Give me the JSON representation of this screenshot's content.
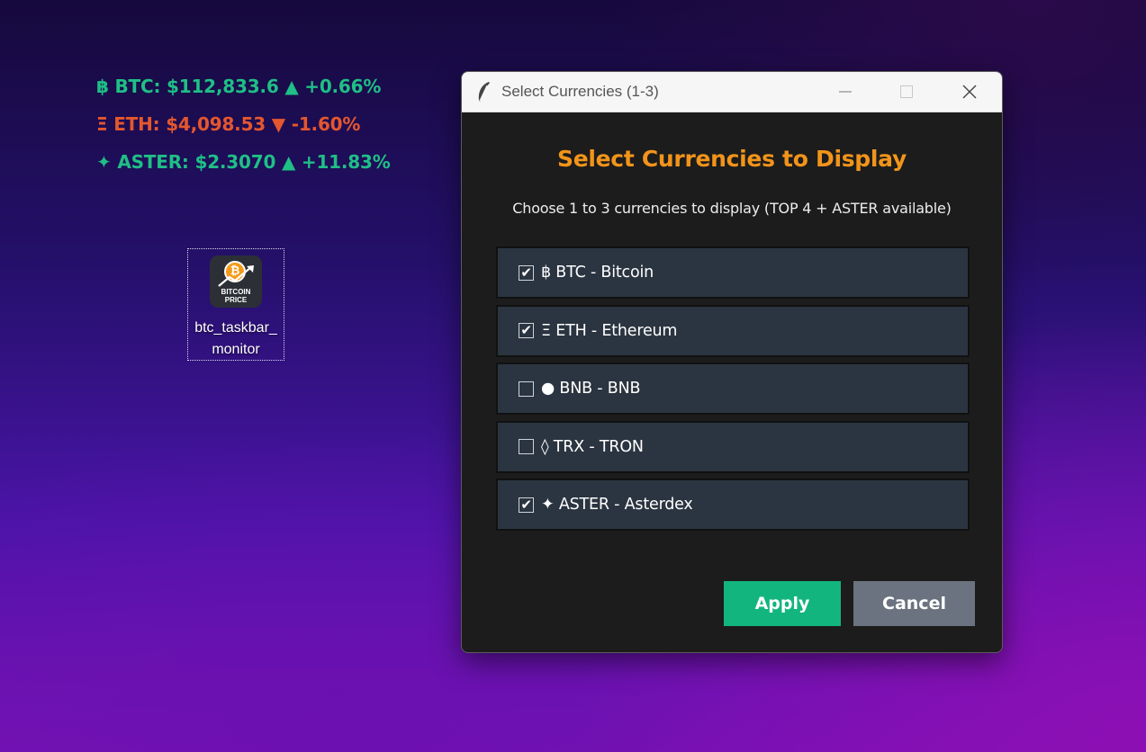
{
  "ticker": [
    {
      "symbol_icon": "฿",
      "text": "BTC: $112,833.6",
      "arrow": "▲",
      "change": "+0.66%",
      "direction": "up",
      "color": "#1fbf86"
    },
    {
      "symbol_icon": "Ξ",
      "text": "ETH: $4,098.53",
      "arrow": "▼",
      "change": "-1.60%",
      "direction": "down",
      "color": "#e4572e"
    },
    {
      "symbol_icon": "✦",
      "text": " ASTER: $2.3070",
      "arrow": "▲",
      "change": "+11.83%",
      "direction": "up",
      "color": "#1fbf86"
    }
  ],
  "desktop_icon": {
    "label_line1": "btc_taskbar_",
    "label_line2": "monitor",
    "image_text_line1": "BITCOIN",
    "image_text_line2": "PRICE",
    "coin_glyph": "₿"
  },
  "dialog": {
    "window_title": "Select Currencies (1-3)",
    "heading": "Select Currencies to Display",
    "subheading": "Choose 1 to 3 currencies to display (TOP 4 + ASTER available)",
    "options": [
      {
        "label": "฿ BTC - Bitcoin",
        "checked": true
      },
      {
        "label": "Ξ ETH - Ethereum",
        "checked": true
      },
      {
        "label": "● BNB - BNB",
        "checked": false
      },
      {
        "label": "◊ TRX - TRON",
        "checked": false
      },
      {
        "label": "✦  ASTER - Asterdex",
        "checked": true
      }
    ],
    "apply_label": "Apply",
    "cancel_label": "Cancel"
  },
  "colors": {
    "heading": "#f2941a",
    "apply": "#13b57f",
    "cancel": "#6b7380",
    "option_bg": "#2b3541",
    "dialog_bg": "#1c1c1c"
  }
}
